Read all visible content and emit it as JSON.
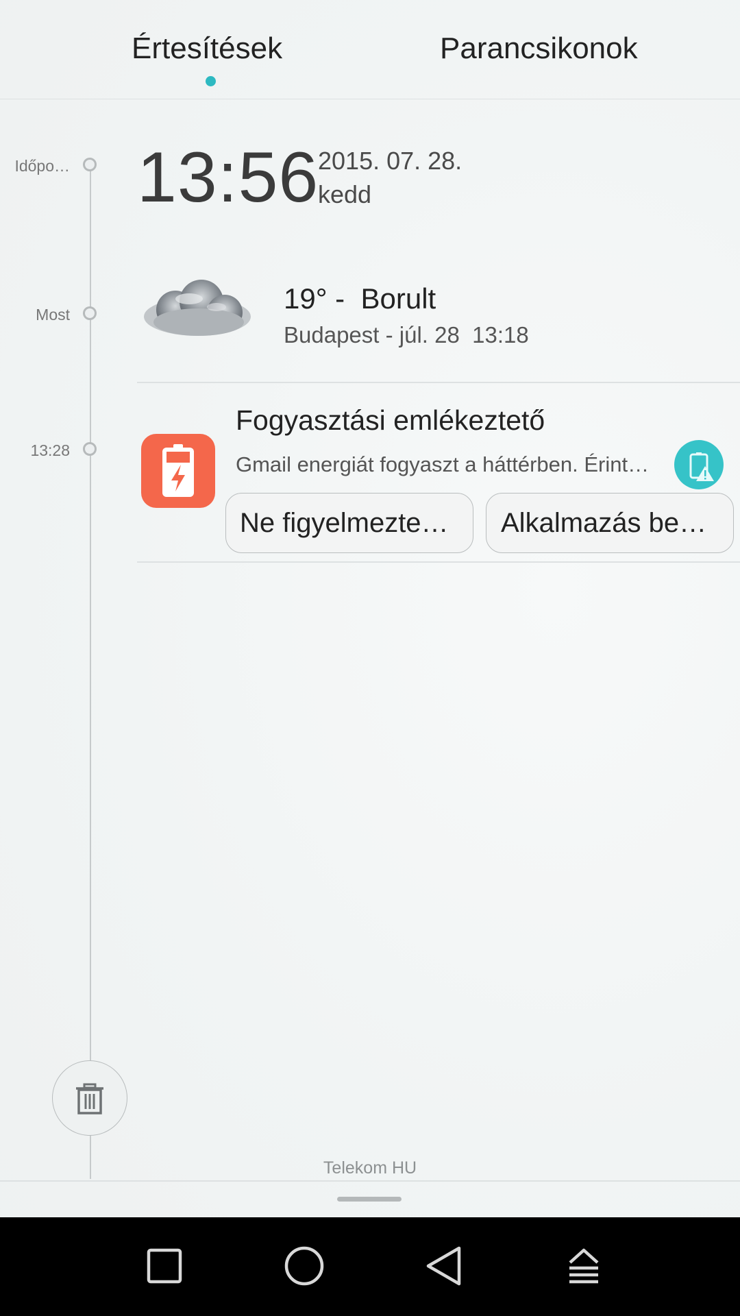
{
  "tabs": {
    "notifications": "Értesítések",
    "shortcuts": "Parancsikonok",
    "accent_color": "#2db9c1"
  },
  "timeline": {
    "labels": [
      "Időpo…",
      "Most",
      "13:28"
    ]
  },
  "clock": {
    "time": "13:56",
    "date": "2015. 07. 28.",
    "weekday": "kedd"
  },
  "weather": {
    "icon": "cloud-icon",
    "temp_line": "19° -  Borult",
    "location_line": "Budapest - júl. 28  13:18"
  },
  "notification": {
    "app_icon": "battery-icon",
    "title": "Fogyasztási emlékeztető",
    "text": "Gmail energiát fogyaszt a háttérben. Érintse meg a részletekért.",
    "badge_icon": "battery-warning-icon",
    "actions": [
      "Ne figyelmezte…",
      "Alkalmazás be…"
    ],
    "colors": {
      "app_icon": "#f4674b",
      "badge": "#36c3c8"
    }
  },
  "footer": {
    "trash_icon": "trash-icon",
    "carrier": "Telekom HU"
  },
  "navbar": {
    "buttons": [
      "recents-icon",
      "home-icon",
      "back-icon",
      "pull-up-icon"
    ]
  }
}
